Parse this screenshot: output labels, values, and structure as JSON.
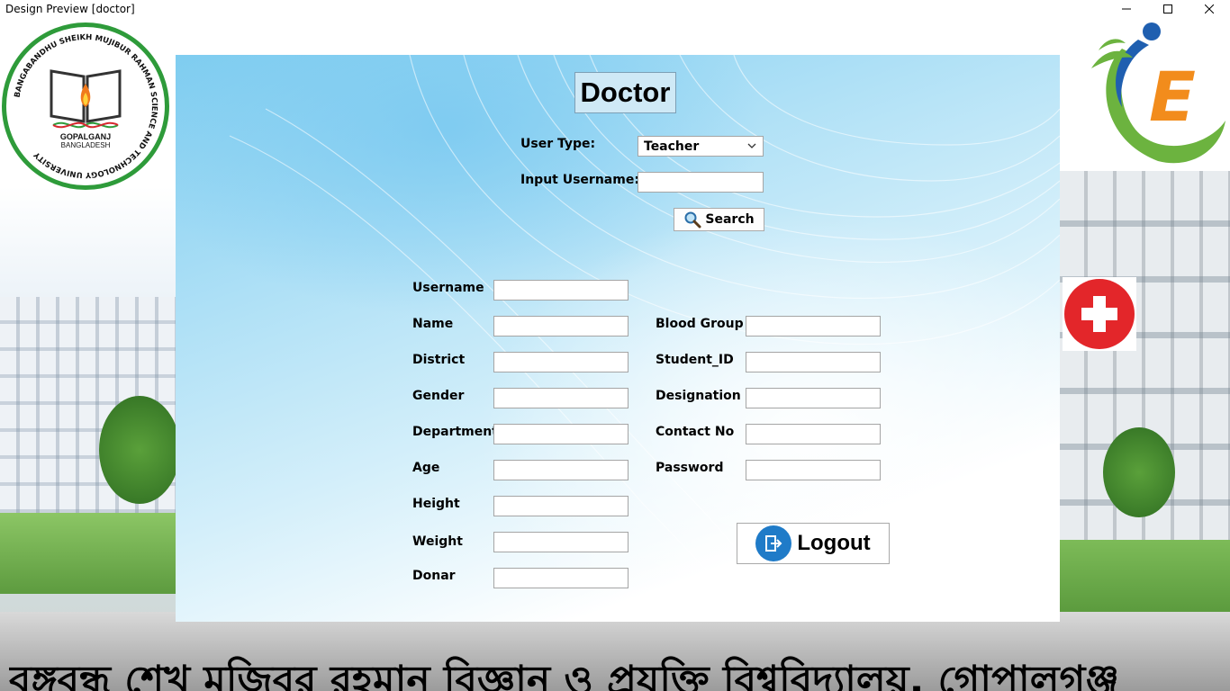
{
  "window": {
    "title": "Design Preview [doctor]"
  },
  "logos": {
    "university_city": "GOPALGANJ",
    "university_country": "BANGLADESH",
    "university_ring_text": "BANGABANDHU SHEIKH MUJIBUR RAHMAN SCIENCE AND TECHNOLOGY UNIVERSITY",
    "brand_letter": "E"
  },
  "form": {
    "heading": "Doctor",
    "user_type_label": "User Type:",
    "user_type_value": "Teacher",
    "input_username_label": "Input Username:",
    "input_username_value": "",
    "search_label": "Search",
    "fields_left": [
      {
        "label": "Username",
        "value": ""
      },
      {
        "label": "Name",
        "value": ""
      },
      {
        "label": "District",
        "value": ""
      },
      {
        "label": "Gender",
        "value": ""
      },
      {
        "label": "Department",
        "value": ""
      },
      {
        "label": "Age",
        "value": ""
      },
      {
        "label": "Height",
        "value": ""
      },
      {
        "label": "Weight",
        "value": ""
      },
      {
        "label": "Donar",
        "value": ""
      }
    ],
    "fields_right": [
      {
        "label": "Blood Group",
        "value": ""
      },
      {
        "label": "Student_ID",
        "value": ""
      },
      {
        "label": "Designation",
        "value": ""
      },
      {
        "label": "Contact No",
        "value": ""
      },
      {
        "label": "Password",
        "value": ""
      }
    ],
    "logout_label": "Logout"
  },
  "banner": {
    "text": "বঙ্গবন্ধু শেখ মুজিবুর রহমান বিজ্ঞান ও প্রযুক্তি বিশ্ববিদ্যালয়, গোপালগঞ্জ"
  },
  "colors": {
    "logo_ring": "#2e9b3a",
    "medical_cross_bg": "#e3262a",
    "logout_icon": "#1f7bc8",
    "brand_orange": "#f28c1c",
    "brand_blue": "#1f5fb0"
  }
}
